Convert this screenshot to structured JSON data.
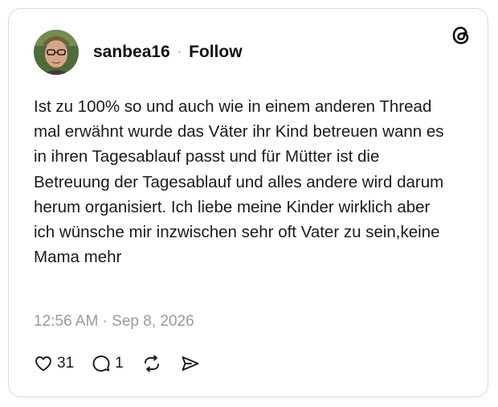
{
  "post": {
    "username": "sanbea16",
    "separator": "·",
    "follow_label": "Follow",
    "text": "Ist zu 100% so und auch wie in einem anderen Thread mal erwähnt wurde das Väter ihr Kind betreuen wann es in ihren Tagesablauf passt und für Mütter ist die Betreuung der Tagesablauf und alles andere wird darum herum organisiert. Ich liebe meine Kinder wirklich aber ich wünsche mir inzwischen sehr oft Vater zu sein,keine Mama mehr",
    "timestamp": "12:56 AM · Sep 8, 2026"
  },
  "actions": {
    "like_count": "31",
    "reply_count": "1",
    "repost_icon": "repost-icon",
    "share_icon": "share-icon"
  },
  "icons": {
    "brand": "threads-logo-icon"
  },
  "colors": {
    "text": "#111111",
    "muted": "#9a9a9a",
    "border": "#d9d9d9"
  }
}
